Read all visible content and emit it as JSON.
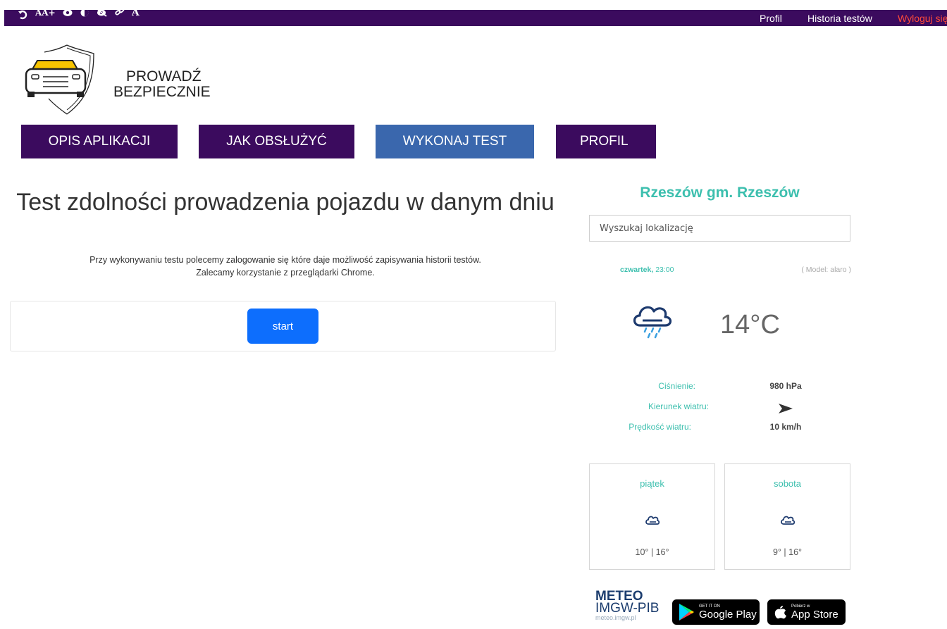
{
  "topbar": {
    "a11y_icons": [
      "reset-icon",
      "font-size-icon",
      "eye-icon",
      "contrast-icon",
      "hide-eye-icon",
      "link-icon",
      "font-icon"
    ],
    "font_size_label": "AA+",
    "font_label": "A",
    "links": {
      "profile": "Profil",
      "history": "Historia testów",
      "logout": "Wyloguj się"
    },
    "colors": {
      "bar": "#3b0b5e",
      "logout": "#ff4a3a"
    }
  },
  "logo": {
    "line1": "PROWADŹ",
    "line2": "BEZPIECZNIE",
    "icon": "car-shield-icon"
  },
  "nav": {
    "items": [
      {
        "label": "OPIS APLIKACJI"
      },
      {
        "label": "JAK OBSŁUŻYĆ"
      },
      {
        "label": "WYKONAJ TEST",
        "active": true
      },
      {
        "label": "PROFIL"
      }
    ],
    "colors": {
      "default": "#3b0b5e",
      "active": "#3a67ad"
    }
  },
  "main": {
    "title": "Test zdolności prowadzenia pojazdu w danym dniu",
    "intro_line1": "Przy wykonywaniu testu polecemy zalogowanie się które daje możliwość zapisywania historii testów.",
    "intro_line2": "Zalecamy korzystanie z przeglądarki Chrome.",
    "start_label": "start"
  },
  "weather": {
    "city": "Rzeszów gm. Rzeszów",
    "search_placeholder": "Wyszukaj lokalizację",
    "day": "czwartek,",
    "time": "23:00",
    "model": "( Model: alaro )",
    "icon": "cloud-rain-icon",
    "temperature": "14°C",
    "pressure_label": "Ciśnienie:",
    "pressure_value": "980 hPa",
    "wind_dir_label": "Kierunek wiatru:",
    "wind_dir_icon": "arrow-right-icon",
    "wind_speed_label": "Prędkość wiatru:",
    "wind_speed_value": "10 km/h",
    "forecast": [
      {
        "day": "piątek",
        "icon": "cloud-icon",
        "temps": "10° | 16°"
      },
      {
        "day": "sobota",
        "icon": "cloud-icon",
        "temps": "9° | 16°"
      }
    ],
    "accent_color": "#3cbfae"
  },
  "footer": {
    "meteo_line1": "METEO",
    "meteo_line2": "IMGW-PIB",
    "meteo_url": "meteo.imgw.pl",
    "google_small": "GET IT ON",
    "google_big": "Google Play",
    "apple_small": "Pobierz w",
    "apple_big": "App Store"
  }
}
